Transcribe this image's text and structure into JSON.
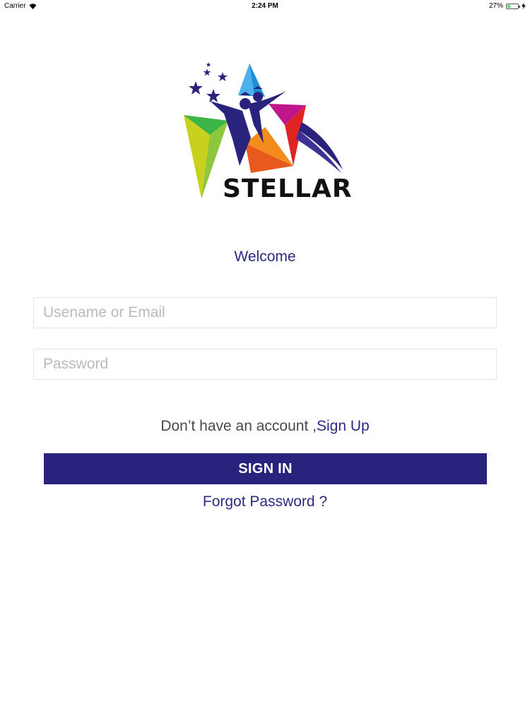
{
  "status_bar": {
    "carrier": "Carrier",
    "time": "2:24 PM",
    "battery_percent": "27%",
    "battery_level": 0.27
  },
  "logo": {
    "text": "STELLAR",
    "colors": {
      "navy": "#2a237e",
      "blue": "#1e8fd8",
      "green": "#3cb44a",
      "yellow": "#c8d21e",
      "orange": "#f28c1c",
      "red": "#e02424",
      "magenta": "#c0168c",
      "purple": "#7b2d8f"
    }
  },
  "welcome": "Welcome",
  "form": {
    "username_placeholder": "Usename or Email",
    "password_placeholder": "Password"
  },
  "signup": {
    "prompt": "Don’t have an account ,",
    "link": "Sign Up"
  },
  "signin_label": "SIGN IN",
  "forgot_label": "Forgot Password ?",
  "colors": {
    "primary": "#2a237e",
    "placeholder": "#b9b9be",
    "border": "#e3e3e3"
  }
}
